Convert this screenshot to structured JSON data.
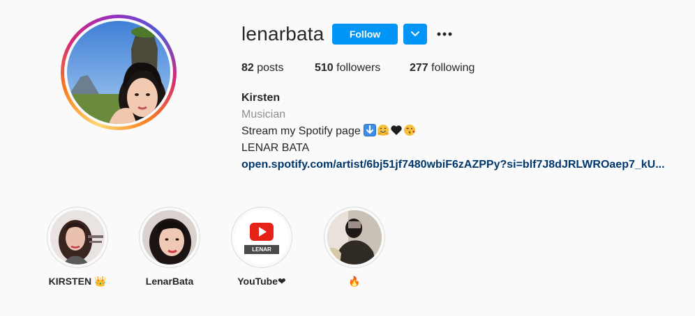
{
  "profile": {
    "username": "lenarbata",
    "follow_label": "Follow",
    "stats": {
      "posts_count": "82",
      "posts_label": "posts",
      "followers_count": "510",
      "followers_label": "followers",
      "following_count": "277",
      "following_label": "following"
    },
    "bio": {
      "name": "Kirsten",
      "category": "Musician",
      "line1": "Stream my Spotify page ",
      "line1_emojis": [
        "down-arrow-emoji",
        "smiling-hug-emoji",
        "black-heart-emoji",
        "kissing-face-emoji"
      ],
      "line2": "LENAR BATA",
      "link": "open.spotify.com/artist/6bj51jf7480wbiF6zAZPPy?si=blf7J8dJRLWROaep7_kU..."
    }
  },
  "highlights": [
    {
      "label": "KIRSTEN 👑"
    },
    {
      "label": "LenarBata"
    },
    {
      "label": "YouTube❤",
      "cover_text": "LENAR BATA"
    },
    {
      "label": "🔥"
    }
  ],
  "colors": {
    "accent": "#0095f6",
    "link": "#00376b",
    "muted": "#8e8e8e",
    "background": "#fafafa"
  }
}
